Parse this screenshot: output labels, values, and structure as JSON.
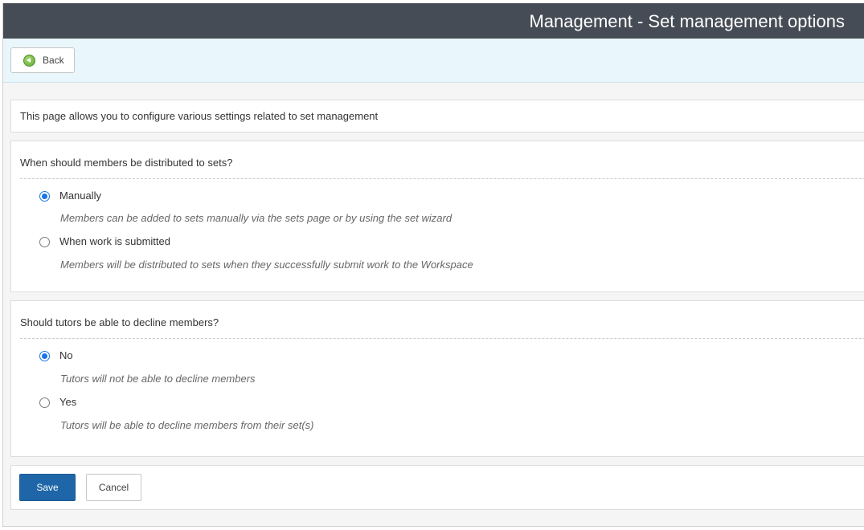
{
  "header": {
    "title": "Management - Set management options"
  },
  "toolbar": {
    "back_label": "Back"
  },
  "intro": {
    "text": "This page allows you to configure various settings related to set management"
  },
  "distribution": {
    "question": "When should members be distributed to sets?",
    "options": [
      {
        "label": "Manually",
        "description": "Members can be added to sets manually via the sets page or by using the set wizard",
        "selected": true
      },
      {
        "label": "When work is submitted",
        "description": "Members will be distributed to sets when they successfully submit work to the Workspace",
        "selected": false
      }
    ]
  },
  "decline": {
    "question": "Should tutors be able to decline members?",
    "options": [
      {
        "label": "No",
        "description": "Tutors will not be able to decline members",
        "selected": true
      },
      {
        "label": "Yes",
        "description": "Tutors will be able to decline members from their set(s)",
        "selected": false
      }
    ]
  },
  "actions": {
    "save_label": "Save",
    "cancel_label": "Cancel"
  },
  "colors": {
    "header_bg": "#454c55",
    "toolbar_bg": "#e9f6fb",
    "primary_button": "#1f66a8",
    "radio_selected": "#1a73e8"
  }
}
